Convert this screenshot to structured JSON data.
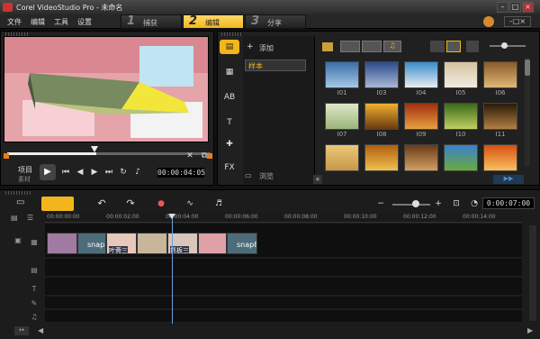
{
  "title": "Corel VideoStudio Pro - 未命名",
  "menu": [
    "文件",
    "编辑",
    "工具",
    "设置"
  ],
  "steps": [
    {
      "num": "1",
      "label": "捕获"
    },
    {
      "num": "2",
      "label": "编辑"
    },
    {
      "num": "3",
      "label": "分享"
    }
  ],
  "player": {
    "project_label": "项目",
    "clip_label": "素材",
    "timecode": "00:00:04:05",
    "progress": 0.44
  },
  "library": {
    "add_label": "添加",
    "folder_label": "样本",
    "browse_label": "浏览",
    "thumbs": [
      "I01",
      "I03",
      "I04",
      "I05",
      "I06",
      "I07",
      "I08",
      "I09",
      "I10",
      "I11",
      "",
      "",
      "",
      "",
      ""
    ]
  },
  "timeline": {
    "timecode": "0:00:07:00",
    "ruler": [
      "00:00:00:00",
      "00:00:02:00",
      "00:00:04:00",
      "00:00:06:00",
      "00:00:08:00",
      "00:00:10:00",
      "00:00:12:00",
      "00:00:14:00"
    ],
    "clips": [
      "snap8",
      "叶斋三",
      "抓板三",
      "snap8"
    ]
  },
  "colors": {
    "accent": "#f2b61c",
    "panel": "#202020"
  }
}
